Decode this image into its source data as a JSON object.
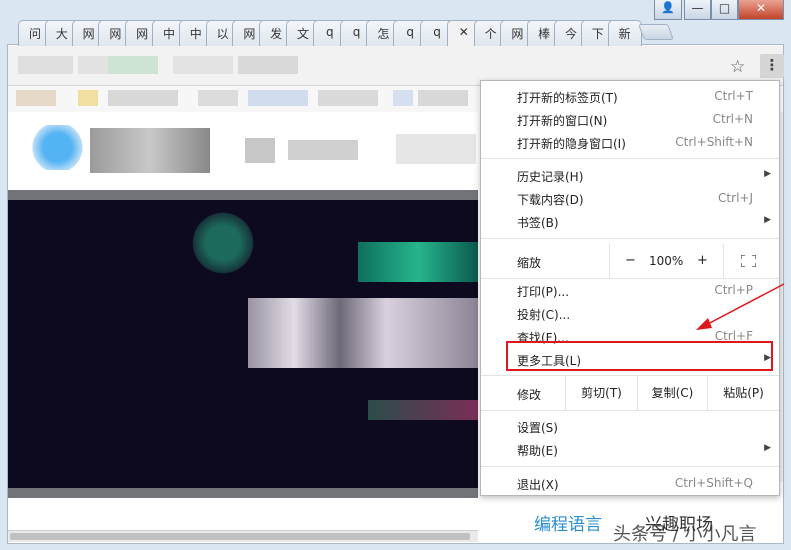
{
  "tabs": [
    "问",
    "大",
    "网",
    "网",
    "网",
    "中",
    "中",
    "以",
    "网",
    "发",
    "文",
    "q",
    "q",
    "怎",
    "q",
    "q",
    "✕",
    "个",
    "网",
    "棒",
    "今",
    "下",
    "新"
  ],
  "active_tab_index": 16,
  "window_controls": {
    "user": "👤",
    "minimize": "—",
    "maximize": "□",
    "close": "✕"
  },
  "toolbar": {
    "star": "☆",
    "menu": "⋮"
  },
  "menu": {
    "new_tab": {
      "label": "打开新的标签页(T)",
      "shortcut": "Ctrl+T"
    },
    "new_window": {
      "label": "打开新的窗口(N)",
      "shortcut": "Ctrl+N"
    },
    "new_incognito": {
      "label": "打开新的隐身窗口(I)",
      "shortcut": "Ctrl+Shift+N"
    },
    "history": {
      "label": "历史记录(H)"
    },
    "downloads": {
      "label": "下载内容(D)",
      "shortcut": "Ctrl+J"
    },
    "bookmarks": {
      "label": "书签(B)"
    },
    "zoom": {
      "label": "缩放",
      "minus": "−",
      "value": "100%",
      "plus": "+"
    },
    "print": {
      "label": "打印(P)...",
      "shortcut": "Ctrl+P"
    },
    "cast": {
      "label": "投射(C)..."
    },
    "find": {
      "label": "查找(F)...",
      "shortcut": "Ctrl+F"
    },
    "more_tools": {
      "label": "更多工具(L)"
    },
    "edit": {
      "label": "修改",
      "cut": "剪切(T)",
      "copy": "复制(C)",
      "paste": "粘贴(P)"
    },
    "settings": {
      "label": "设置(S)"
    },
    "help": {
      "label": "帮助(E)"
    },
    "exit": {
      "label": "退出(X)",
      "shortcut": "Ctrl+Shift+Q"
    }
  },
  "watermark": {
    "left": "编程语言",
    "right": "兴趣职场",
    "overlay": "头条号 / 小小凡言"
  },
  "colors": {
    "highlight": "#e0161d",
    "banner_bg": "#0d0a1f",
    "watermark_blue": "#2a8ed0"
  }
}
